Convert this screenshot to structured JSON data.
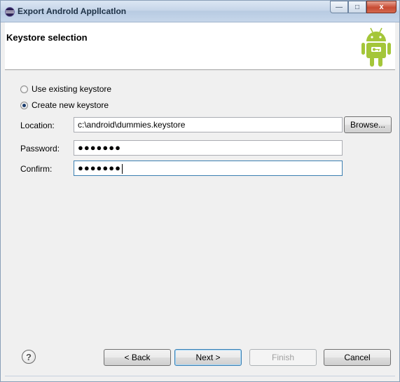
{
  "window": {
    "title": "Export Androld Appllcatlon",
    "minimize_glyph": "—",
    "maximize_glyph": "□",
    "close_glyph": "x"
  },
  "banner": {
    "title": "Keystore selection",
    "logo_icon": "android-robot-icon"
  },
  "keystore_options": {
    "use_existing_label": "Use existing keystore",
    "create_new_label": "Create new keystore",
    "selected": "create_new"
  },
  "fields": {
    "location_label": "Location:",
    "location_value": "c:\\android\\dummies.keystore",
    "browse_label": "Browse...",
    "password_label": "Password:",
    "password_value": "●●●●●●●",
    "confirm_label": "Confirm:",
    "confirm_value": "●●●●●●●"
  },
  "buttons": {
    "help_icon": "help-icon",
    "help_glyph": "?",
    "back_label": "< Back",
    "next_label": "Next >",
    "finish_label": "Finish",
    "cancel_label": "Cancel"
  },
  "colors": {
    "android_green": "#a4c639",
    "titlebar": "#c7d6e9",
    "close_button": "#c74b33"
  }
}
